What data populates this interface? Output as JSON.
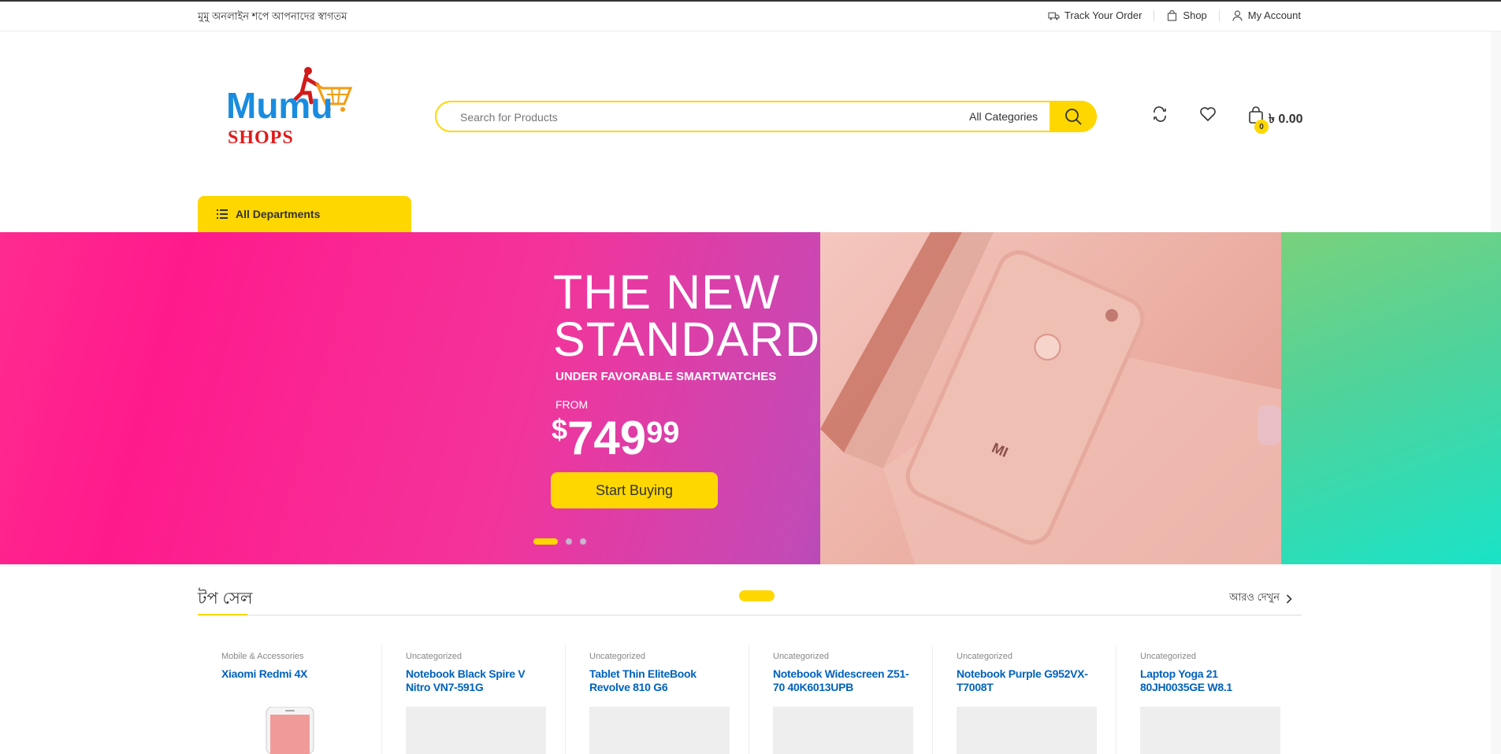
{
  "topbar": {
    "welcome": "মুমু অনলাইন শপে আপনাদের স্বাগতম",
    "track_order": "Track Your Order",
    "shop": "Shop",
    "my_account": "My Account"
  },
  "header": {
    "logo_text_top": "Mumu",
    "logo_text_bottom": "SHOPS",
    "search_placeholder": "Search for Products",
    "category_selected": "All Categories",
    "cart_count": "0",
    "cart_total": "৳ 0.00"
  },
  "nav": {
    "departments_label": "All Departments"
  },
  "hero": {
    "title": "THE NEW\nSTANDARD",
    "subtitle": "UNDER FAVORABLE SMARTWATCHES",
    "from_label": "FROM",
    "price_currency": "$",
    "price_int": "749",
    "price_dec": "99",
    "cta": "Start Buying",
    "phone_brand": "MI",
    "slides_total": 3,
    "slide_active": 1
  },
  "top_sellers": {
    "title": "টপ সেল",
    "see_more": "আরও দেখুন",
    "products": [
      {
        "category": "Mobile & Accessories",
        "name": "Xiaomi Redmi 4X"
      },
      {
        "category": "Uncategorized",
        "name": "Notebook Black Spire V Nitro VN7-591G"
      },
      {
        "category": "Uncategorized",
        "name": "Tablet Thin EliteBook Revolve 810 G6"
      },
      {
        "category": "Uncategorized",
        "name": "Notebook Widescreen Z51-70 40K6013UPB"
      },
      {
        "category": "Uncategorized",
        "name": "Notebook Purple G952VX-T7008T"
      },
      {
        "category": "Uncategorized",
        "name": "Laptop Yoga 21 80JH0035GE W8.1"
      }
    ]
  },
  "colors": {
    "accent": "#fed700",
    "link": "#0062bd",
    "hero_pink": "#ff1a8c",
    "hero_purple": "#9e48bb"
  },
  "icons": [
    "truck-icon",
    "bag-icon",
    "user-icon",
    "search-icon",
    "compare-icon",
    "heart-icon",
    "cart-icon",
    "list-icon",
    "chevron-right-icon",
    "updown-icon"
  ]
}
